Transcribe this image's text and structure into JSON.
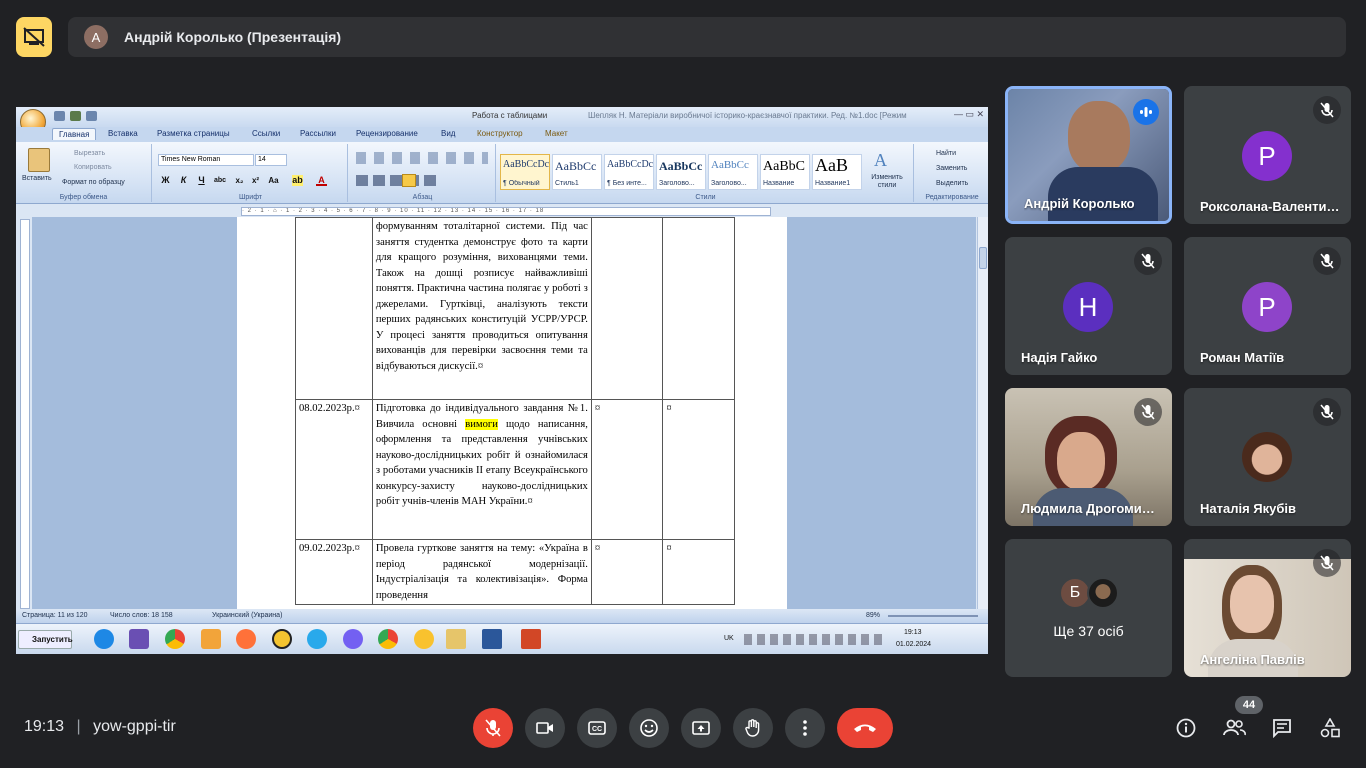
{
  "presentation": {
    "avatar_letter": "А",
    "title": "Андрій Королько (Презентація)"
  },
  "word": {
    "title_tables": "Работа с таблицами",
    "title_doc": "Шепляк Н. Матеріали виробничої історико-краєзнавчої практики. Ред. №1.doc [Режим",
    "tabs": [
      "Главная",
      "Вставка",
      "Разметка страницы",
      "Ссылки",
      "Рассылки",
      "Рецензирование",
      "Вид",
      "Конструктор",
      "Макет"
    ],
    "clipboard": {
      "paste": "Вставить",
      "cut": "Вырезать",
      "copy": "Копировать",
      "format_painter": "Формат по образцу",
      "label": "Буфер обмена"
    },
    "font": {
      "name": "Times New Roman",
      "size": "14",
      "label": "Шрифт",
      "b": "Ж",
      "i": "К",
      "u": "Ч"
    },
    "paragraph_label": "Абзац",
    "styles": [
      {
        "sample": "AaBbCcDc",
        "name": "¶ Обычный"
      },
      {
        "sample": "AaBbCc",
        "name": "Стиль1"
      },
      {
        "sample": "AaBbCcDc",
        "name": "¶ Без инте..."
      },
      {
        "sample": "AaBbCc",
        "name": "Заголово..."
      },
      {
        "sample": "AaBbCc",
        "name": "Заголово..."
      },
      {
        "sample": "AaBbC",
        "name": "Название"
      },
      {
        "sample": "AaB",
        "name": "Название1"
      }
    ],
    "change_styles": "Изменить стили",
    "styles_label": "Стили",
    "editing": {
      "find": "Найти",
      "replace": "Заменить",
      "select": "Выделить",
      "label": "Редактирование"
    },
    "ruler_text": "· 2 · 1 · ⌂ · 1 · 2 · 3 · 4 · 5 · 6 · 7 · 8 · 9 · 10 · 11 · 12 · 13 · 14 · 15 · 16 · 17 · 18",
    "table_rows": [
      {
        "date": "",
        "text": "формуванням тоталітарної системи. Під час заняття студентка демонструє фото та карти для кращого розуміння, вихованцями теми. Також на дошці розписує найважливіші поняття. Практична частина полягає у роботі з джерелами. Гуртківці, аналізують тексти перших радянських конституцій УСРР/УРСР. У процесі заняття проводиться опитування вихованців для перевірки засвоєння теми та відбуваються дискусії.¤",
        "e1": "",
        "e2": ""
      },
      {
        "date": "08.02.2023р.¤",
        "text_before": "Підготовка до індивідуального завдання №1. Вивчила основні ",
        "text_highlight": "вимоги",
        "text_after": " щодо написання, оформлення та представлення учнівських науково-дослідницьких робіт й ознайомилася з роботами учасників ІІ етапу Всеукраїнського конкурсу-захисту науково-дослідницьких робіт учнів-членів МАН України.¤",
        "e1": "¤",
        "e2": "¤"
      },
      {
        "date": "09.02.2023р.¤",
        "text": "Провела гурткове заняття на тему: «Україна в період радянської модернізації. Індустріалізація та колективізація». Форма проведення",
        "e1": "¤",
        "e2": "¤"
      }
    ],
    "status": {
      "page": "Страница: 11 из 120",
      "words": "Число слов: 18 158",
      "lang": "Украинский (Украина)",
      "zoom": "89%"
    },
    "taskbar": {
      "start": "Запустить",
      "lang": "UK",
      "time": "19:13",
      "date": "01.02.2024"
    }
  },
  "participants": [
    {
      "name": "Андрій Королько",
      "speaking": true
    },
    {
      "name": "Роксолана-Валентина...",
      "letter": "Р",
      "color": "#8430ce"
    },
    {
      "name": "Надія Гайко",
      "letter": "Н",
      "color": "#5b2fbf"
    },
    {
      "name": "Роман Матіїв",
      "letter": "Р",
      "color": "#8e44c9"
    },
    {
      "name": "Людмила Дрогомирецька",
      "muted": true
    },
    {
      "name": "Наталія Якубів",
      "muted": true
    },
    {
      "name": "Ще 37 осіб",
      "letter": "Б"
    },
    {
      "name": "Ангеліна Павлів",
      "muted": true
    }
  ],
  "meeting": {
    "time": "19:13",
    "separator": "|",
    "code": "yow-gppi-tir",
    "people_count": "44"
  },
  "colors": {
    "accent": "#8ab4f8",
    "end_call": "#ea4335",
    "bg": "#202124",
    "tile": "#3c4043"
  }
}
